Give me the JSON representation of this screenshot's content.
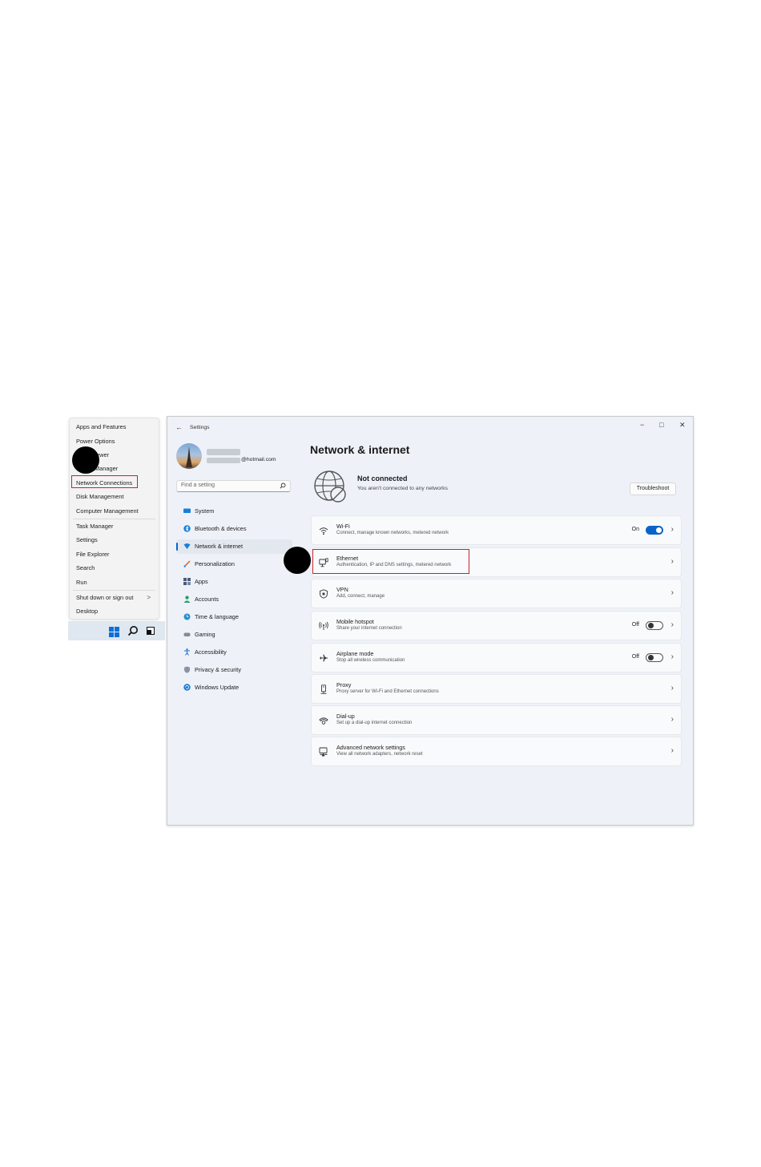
{
  "winx_menu": {
    "items": [
      {
        "label": "Apps and Features"
      },
      {
        "label": "Power Options"
      },
      {
        "label": "Event Viewer",
        "visible_text": "ewer"
      },
      {
        "label": "Device Manager",
        "visible_text": "Manager"
      },
      {
        "label": "Network Connections",
        "highlighted": true
      },
      {
        "label": "Disk Management"
      },
      {
        "label": "Computer Management"
      },
      {
        "label": "Task Manager"
      },
      {
        "label": "Settings"
      },
      {
        "label": "File Explorer"
      },
      {
        "label": "Search"
      },
      {
        "label": "Run"
      },
      {
        "label": "Shut down or sign out",
        "submenu_arrow": ">"
      },
      {
        "label": "Desktop"
      }
    ]
  },
  "taskbar": {
    "icons": [
      "windows-start-icon",
      "search-icon",
      "task-view-icon"
    ],
    "accent": "#0a6fd8"
  },
  "settings": {
    "window_title": "Settings",
    "window_controls": {
      "minimize": "−",
      "maximize": "□",
      "close": "✕"
    },
    "profile": {
      "email_suffix": "@hotmail.com"
    },
    "search_placeholder": "Find a setting",
    "nav": [
      {
        "label": "System",
        "icon": "system-icon",
        "color": "#1a7fd9"
      },
      {
        "label": "Bluetooth & devices",
        "icon": "bluetooth-icon",
        "color": "#1a7fd9"
      },
      {
        "label": "Network & internet",
        "icon": "network-icon",
        "color": "#1a7fd9",
        "selected": true
      },
      {
        "label": "Personalization",
        "icon": "brush-icon",
        "color": "#e2702a"
      },
      {
        "label": "Apps",
        "icon": "apps-icon",
        "color": "#4b5b78"
      },
      {
        "label": "Accounts",
        "icon": "account-icon",
        "color": "#2aa06a"
      },
      {
        "label": "Time & language",
        "icon": "globe-clock-icon",
        "color": "#2a8fd0"
      },
      {
        "label": "Gaming",
        "icon": "gamepad-icon",
        "color": "#707070"
      },
      {
        "label": "Accessibility",
        "icon": "accessibility-icon",
        "color": "#1a6fcf"
      },
      {
        "label": "Privacy & security",
        "icon": "shield-icon",
        "color": "#6e7787"
      },
      {
        "label": "Windows Update",
        "icon": "update-icon",
        "color": "#1a7fd9"
      }
    ],
    "page_title": "Network & internet",
    "status": {
      "title": "Not connected",
      "subtitle": "You aren't connected to any networks",
      "button": "Troubleshoot"
    },
    "cards": [
      {
        "title": "Wi-Fi",
        "subtitle": "Connect, manage known networks, metered network",
        "icon": "wifi-icon",
        "toggle_label": "On",
        "toggle": "on"
      },
      {
        "title": "Ethernet",
        "subtitle": "Authentication, IP and DNS settings, metered network",
        "icon": "ethernet-icon",
        "highlighted": true
      },
      {
        "title": "VPN",
        "subtitle": "Add, connect, manage",
        "icon": "vpn-shield-icon"
      },
      {
        "title": "Mobile hotspot",
        "subtitle": "Share your internet connection",
        "icon": "hotspot-icon",
        "toggle_label": "Off",
        "toggle": "off"
      },
      {
        "title": "Airplane mode",
        "subtitle": "Stop all wireless communication",
        "icon": "airplane-icon",
        "toggle_label": "Off",
        "toggle": "off"
      },
      {
        "title": "Proxy",
        "subtitle": "Proxy server for Wi-Fi and Ethernet connections",
        "icon": "proxy-icon"
      },
      {
        "title": "Dial-up",
        "subtitle": "Set up a dial-up internet connection",
        "icon": "dialup-icon"
      },
      {
        "title": "Advanced network settings",
        "subtitle": "View all network adapters, network reset",
        "icon": "advanced-network-icon"
      }
    ],
    "chevron": "›",
    "highlight_color": "#c8202d",
    "accent_color": "#0a64c7"
  }
}
